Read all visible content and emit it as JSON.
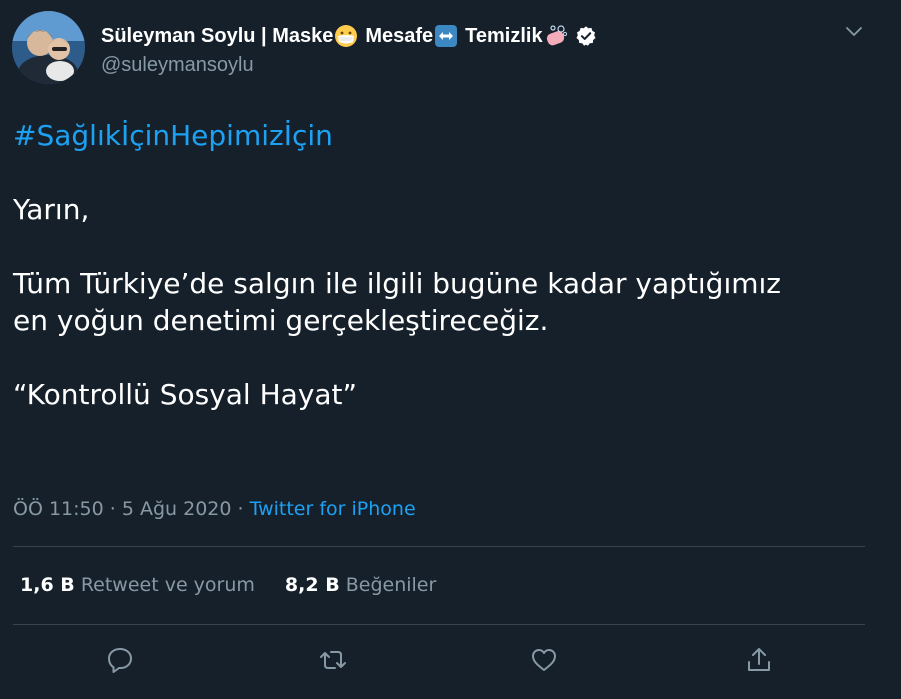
{
  "user": {
    "name_parts": [
      "Süleyman Soylu | Maske",
      "Mesafe",
      "Temizlik"
    ],
    "handle": "@suleymansoylu",
    "verified": true,
    "emoji_icons": [
      "face-with-medical-mask-icon",
      "left-right-arrow-icon",
      "soap-bubbles-icon"
    ]
  },
  "tweet": {
    "hashtag": "#SağlıkİçinHepimizİçin",
    "line1": "Yarın,",
    "line2a": "Tüm Türkiye’de salgın ile ilgili bugüne kadar yaptığımız",
    "line2b": "en yoğun denetimi gerçekleştireceğiz.",
    "quote": "“Kontrollü Sosyal Hayat”"
  },
  "meta": {
    "time": "ÖÖ 11:50",
    "sep": "·",
    "date": "5 Ağu 2020",
    "source": "Twitter for iPhone"
  },
  "stats": {
    "retweets_count": "1,6 B",
    "retweets_label": "Retweet ve yorum",
    "likes_count": "8,2 B",
    "likes_label": "Beğeniler"
  },
  "colors": {
    "background": "#15202b",
    "accent": "#1da1f2",
    "secondary_text": "#8899a6",
    "divider": "#38444d"
  },
  "actions": [
    "reply-icon",
    "retweet-icon",
    "like-icon",
    "share-icon"
  ]
}
